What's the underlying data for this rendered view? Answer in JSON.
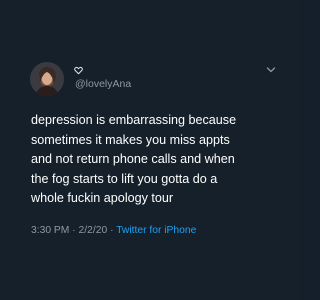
{
  "tweet": {
    "handle": "@lovelyAna",
    "lines": [
      "depression is embarrassing because",
      "sometimes it makes you miss appts",
      "and not return phone calls and when",
      "the fog starts to lift you gotta do a",
      "whole fuckin apology tour"
    ],
    "time": "3:30 PM",
    "separator": "·",
    "date": "2/2/20",
    "source": "Twitter for iPhone"
  },
  "icons": {
    "heart": "heart-outline-icon",
    "chevron": "chevron-down-icon"
  },
  "colors": {
    "background": "#15202b",
    "text": "#ffffff",
    "secondary": "#8b98a5",
    "link": "#1da1f2"
  }
}
